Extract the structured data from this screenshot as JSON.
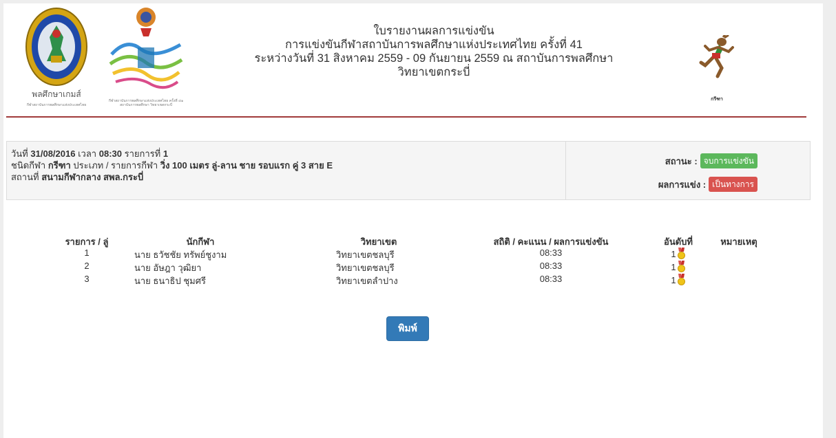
{
  "header": {
    "title_line1": "ใบรายงานผลการแข่งขัน",
    "title_line2": "การแข่งขันกีฬาสถาบันการพลศึกษาแห่งประเทศไทย ครั้งที่ 41",
    "title_line3": "ระหว่างวันที่ 31 สิงหาคม 2559 - 09 กันยายน 2559 ณ สถาบันการพลศึกษา",
    "title_line4": "วิทยาเขตกระบี่",
    "logo1_caption": "พลศึกษาเกมส์",
    "logo1_sub": "กีฬาสถาบันการพลศึกษาแห่งประเทศไทย",
    "logo2_sub": "กีฬาสถาบันการพลศึกษาแห่งประเทศไทย ครั้งที่ ๔๑ สถาบันการพลศึกษา วิทยาเขตกระบี่",
    "logo3_caption": "กรีฑา"
  },
  "info": {
    "date_label": "วันที่",
    "date_value": "31/08/2016",
    "time_label": "เวลา",
    "time_value": "08:30",
    "item_label": "รายการที่",
    "item_value": "1",
    "sport_label": "ชนิดกีฬา",
    "sport_value": "กรีฑา",
    "type_label": "ประเภท / รายการกีฬา",
    "type_value": "วิ่ง 100 เมตร  ลู่-ลาน  ชาย  รอบแรก คู่ 3 สาย E",
    "venue_label": "สถานที่",
    "venue_value": "สนามกีฬากลาง สพล.กระบี่"
  },
  "status": {
    "status_label": "สถานะ :",
    "status_value": "จบการแข่งขัน",
    "result_label": "ผลการแข่ง :",
    "result_value": "เป็นทางการ"
  },
  "table": {
    "headers": {
      "item": "รายการ / ลู่",
      "athlete": "นักกีฬา",
      "campus": "วิทยาเขต",
      "stat": "สถิติ / คะแนน / ผลการแข่งขัน",
      "rank": "อันดับที่",
      "note": "หมายเหตุ"
    },
    "rows": [
      {
        "item": "1",
        "athlete": "นาย  ธวัชชัย ทรัพย์ชูงาม",
        "campus": "วิทยาเขตชลบุรี",
        "stat": "08:33",
        "rank": "1",
        "note": ""
      },
      {
        "item": "2",
        "athlete": "นาย  อัษฎา วุฒิยา",
        "campus": "วิทยาเขตชลบุรี",
        "stat": "08:33",
        "rank": "1",
        "note": ""
      },
      {
        "item": "3",
        "athlete": "นาย  ธนาธิป ชุมศรี",
        "campus": "วิทยาเขตลำปาง",
        "stat": "08:33",
        "rank": "1",
        "note": ""
      }
    ]
  },
  "actions": {
    "print_label": "พิมพ์"
  },
  "icons": {
    "logo1": "institute-seal-logo",
    "logo2": "games-41-logo",
    "logo3": "athletics-runner-logo",
    "medal": "gold-medal-icon"
  },
  "colors": {
    "divider": "#a03a3a",
    "status_badge": "#5cb85c",
    "result_badge": "#d9534f",
    "print_button": "#337ab7"
  }
}
